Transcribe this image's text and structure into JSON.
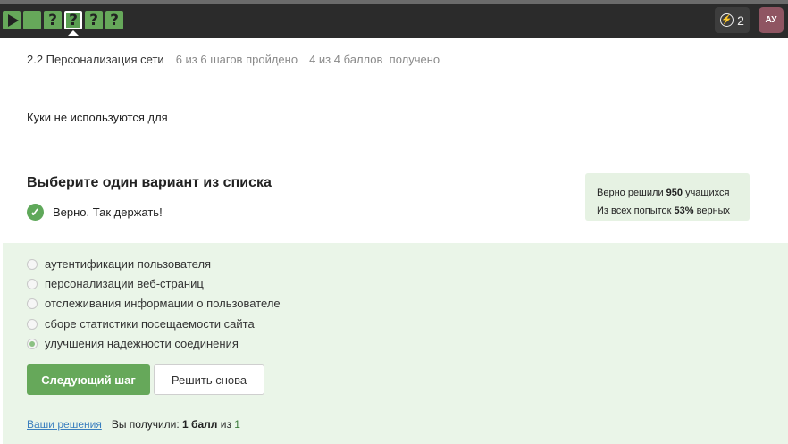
{
  "topbar": {
    "steps": [
      {
        "glyph": ""
      },
      {
        "glyph": ""
      },
      {
        "glyph": "?"
      },
      {
        "glyph": "?"
      },
      {
        "glyph": "?"
      },
      {
        "glyph": "?"
      }
    ],
    "energy_count": "2",
    "avatar_initials": "АУ",
    "accent_color": "#66a85a"
  },
  "lesson": {
    "title": "2.2 Персонализация сети",
    "progress": "6 из 6 шагов пройдено",
    "points_value": "4 из 4 баллов",
    "points_label": "получено"
  },
  "question": {
    "text": "Куки не используются для"
  },
  "task": {
    "title": "Выберите один вариант из списка",
    "feedback": "Верно. Так держать!"
  },
  "stats": {
    "solved_prefix": "Верно решили",
    "solved_count": "950",
    "solved_suffix": "учащихся",
    "attempts_prefix": "Из всех попыток",
    "attempts_percent": "53%",
    "attempts_suffix": "верных"
  },
  "options": [
    {
      "label": "аутентификации пользователя",
      "checked": false
    },
    {
      "label": "персонализации веб-страниц",
      "checked": false
    },
    {
      "label": "отслеживания информации о пользователе",
      "checked": false
    },
    {
      "label": "сборе статистики посещаемости сайта",
      "checked": false
    },
    {
      "label": "улучшения надежности соединения",
      "checked": true
    }
  ],
  "buttons": {
    "next": "Следующий шаг",
    "retry": "Решить снова"
  },
  "footer": {
    "solutions_link": "Ваши решения",
    "score_prefix": "Вы получили:",
    "score_value": "1 балл",
    "score_of": "из",
    "score_total": "1"
  }
}
